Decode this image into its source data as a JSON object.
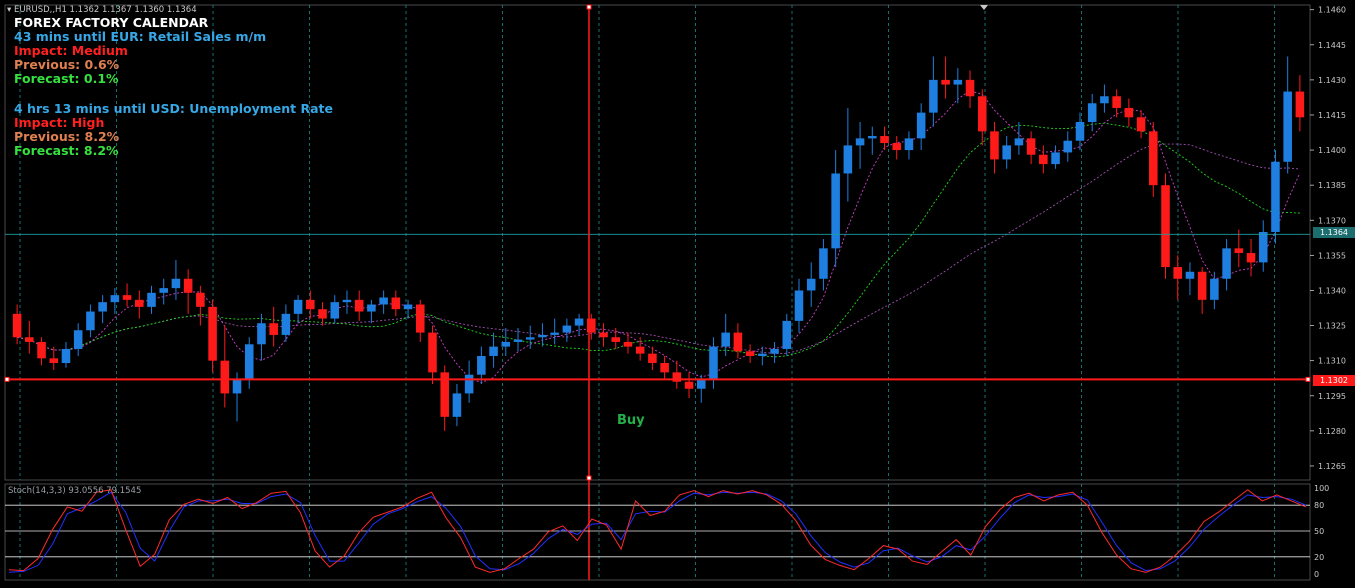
{
  "symbol_bar": {
    "text": "EURUSD,,H1  1.1362 1.1367 1.1360 1.1364"
  },
  "calendar": {
    "title": "FOREX FACTORY CALENDAR",
    "events": [
      {
        "countdown": "43 mins until EUR: Retail Sales m/m",
        "impact": "Impact: Medium",
        "previous": "Previous: 0.6%",
        "forecast": "Forecast: 0.1%"
      },
      {
        "countdown": "4 hrs 13 mins until USD: Unemployment Rate",
        "impact": "Impact: High",
        "previous": "Previous: 8.2%",
        "forecast": "Forecast: 8.2%"
      }
    ]
  },
  "colors": {
    "background": "#000000",
    "bull": "#1e7fe0",
    "bear": "#ff1a1a",
    "ma_fast": "#d040d0",
    "ma_mid": "#1fd81f",
    "ma_slow": "#a050b0",
    "grid": "#1c9fa0",
    "axis": "#c8c8c8",
    "stoch_main": "#ff2a2a",
    "stoch_signal": "#2030ff",
    "calendar_title": "#ffffff",
    "calendar_countdown": "#36a8e6",
    "impact": "#ff2020",
    "previous": "#e08050",
    "forecast": "#36e040"
  },
  "annotation": {
    "buy_label": "Buy"
  },
  "stochastic": {
    "label": "Stoch(14,3,3) 93.0556 79.1545",
    "levels": [
      "100",
      "80",
      "50",
      "20",
      "0"
    ]
  },
  "chart_data": {
    "type": "candlestick",
    "price_axis": {
      "ticks": [
        "1.1460",
        "1.1445",
        "1.1430",
        "1.1415",
        "1.1400",
        "1.1385",
        "1.1370",
        "1.1355",
        "1.1340",
        "1.1325",
        "1.1310",
        "1.1295",
        "1.1280",
        "1.1265"
      ],
      "current_price": "1.1364",
      "marked_price": "1.1302"
    },
    "ylim": [
      1.1259,
      1.1462
    ],
    "candles": [
      [
        1.133,
        1.1334,
        1.1317,
        1.132
      ],
      [
        1.132,
        1.1327,
        1.1313,
        1.1318
      ],
      [
        1.1318,
        1.132,
        1.1308,
        1.1311
      ],
      [
        1.1311,
        1.1316,
        1.1306,
        1.1309
      ],
      [
        1.1309,
        1.1318,
        1.1307,
        1.1315
      ],
      [
        1.1315,
        1.1326,
        1.1312,
        1.1323
      ],
      [
        1.1323,
        1.1334,
        1.132,
        1.1331
      ],
      [
        1.1331,
        1.1338,
        1.1326,
        1.1335
      ],
      [
        1.1335,
        1.1341,
        1.133,
        1.1338
      ],
      [
        1.1338,
        1.1343,
        1.1333,
        1.1336
      ],
      [
        1.1336,
        1.134,
        1.1328,
        1.1333
      ],
      [
        1.1333,
        1.1342,
        1.133,
        1.1339
      ],
      [
        1.1339,
        1.1345,
        1.1334,
        1.1341
      ],
      [
        1.1341,
        1.1353,
        1.1336,
        1.1345
      ],
      [
        1.1345,
        1.1349,
        1.133,
        1.1339
      ],
      [
        1.1339,
        1.1342,
        1.1325,
        1.1333
      ],
      [
        1.1333,
        1.1336,
        1.1305,
        1.131
      ],
      [
        1.131,
        1.1325,
        1.129,
        1.1296
      ],
      [
        1.1296,
        1.1305,
        1.1284,
        1.1302
      ],
      [
        1.1302,
        1.132,
        1.1298,
        1.1317
      ],
      [
        1.1317,
        1.133,
        1.131,
        1.1326
      ],
      [
        1.1326,
        1.1333,
        1.1316,
        1.1321
      ],
      [
        1.1321,
        1.1334,
        1.1318,
        1.133
      ],
      [
        1.133,
        1.1338,
        1.1326,
        1.1336
      ],
      [
        1.1336,
        1.134,
        1.1328,
        1.1332
      ],
      [
        1.1332,
        1.1335,
        1.1325,
        1.1328
      ],
      [
        1.1328,
        1.1338,
        1.1326,
        1.1335
      ],
      [
        1.1335,
        1.134,
        1.133,
        1.1336
      ],
      [
        1.1336,
        1.134,
        1.1327,
        1.1331
      ],
      [
        1.1331,
        1.1336,
        1.1326,
        1.1334
      ],
      [
        1.1334,
        1.134,
        1.133,
        1.1337
      ],
      [
        1.1337,
        1.134,
        1.1329,
        1.1332
      ],
      [
        1.1332,
        1.1336,
        1.1328,
        1.1334
      ],
      [
        1.1334,
        1.1336,
        1.1318,
        1.1322
      ],
      [
        1.1322,
        1.1325,
        1.13,
        1.1305
      ],
      [
        1.1305,
        1.1308,
        1.128,
        1.1286
      ],
      [
        1.1286,
        1.13,
        1.1282,
        1.1296
      ],
      [
        1.1296,
        1.131,
        1.1292,
        1.1304
      ],
      [
        1.1304,
        1.1316,
        1.13,
        1.1312
      ],
      [
        1.1312,
        1.1322,
        1.1307,
        1.1316
      ],
      [
        1.1316,
        1.1324,
        1.1312,
        1.1318
      ],
      [
        1.1318,
        1.1324,
        1.1314,
        1.1319
      ],
      [
        1.1319,
        1.1325,
        1.1315,
        1.132
      ],
      [
        1.132,
        1.1326,
        1.1316,
        1.1321
      ],
      [
        1.1321,
        1.1328,
        1.1317,
        1.1322
      ],
      [
        1.1322,
        1.1328,
        1.1318,
        1.1325
      ],
      [
        1.1325,
        1.133,
        1.1321,
        1.1328
      ],
      [
        1.1328,
        1.133,
        1.1319,
        1.1322
      ],
      [
        1.1322,
        1.1326,
        1.1316,
        1.132
      ],
      [
        1.132,
        1.1324,
        1.1315,
        1.1318
      ],
      [
        1.1318,
        1.1322,
        1.1313,
        1.1316
      ],
      [
        1.1316,
        1.132,
        1.131,
        1.1313
      ],
      [
        1.1313,
        1.1316,
        1.1306,
        1.1309
      ],
      [
        1.1309,
        1.1312,
        1.1302,
        1.1305
      ],
      [
        1.1305,
        1.131,
        1.1298,
        1.1301
      ],
      [
        1.1301,
        1.1305,
        1.1294,
        1.1298
      ],
      [
        1.1298,
        1.1304,
        1.1292,
        1.1302
      ],
      [
        1.1302,
        1.132,
        1.1298,
        1.1316
      ],
      [
        1.1316,
        1.133,
        1.1312,
        1.1322
      ],
      [
        1.1322,
        1.1326,
        1.1311,
        1.1314
      ],
      [
        1.1314,
        1.1317,
        1.1309,
        1.1312
      ],
      [
        1.1312,
        1.1316,
        1.1308,
        1.1313
      ],
      [
        1.1313,
        1.1318,
        1.1309,
        1.1315
      ],
      [
        1.1315,
        1.133,
        1.1312,
        1.1327
      ],
      [
        1.1327,
        1.1345,
        1.1322,
        1.134
      ],
      [
        1.134,
        1.1352,
        1.1333,
        1.1345
      ],
      [
        1.1345,
        1.1362,
        1.134,
        1.1358
      ],
      [
        1.1358,
        1.14,
        1.135,
        1.139
      ],
      [
        1.139,
        1.1418,
        1.1378,
        1.1402
      ],
      [
        1.1402,
        1.1412,
        1.1392,
        1.1405
      ],
      [
        1.1405,
        1.141,
        1.1398,
        1.1406
      ],
      [
        1.1406,
        1.141,
        1.14,
        1.1403
      ],
      [
        1.1403,
        1.1406,
        1.1396,
        1.14
      ],
      [
        1.14,
        1.1408,
        1.1396,
        1.1405
      ],
      [
        1.1405,
        1.142,
        1.14,
        1.1416
      ],
      [
        1.1416,
        1.144,
        1.141,
        1.143
      ],
      [
        1.143,
        1.144,
        1.1422,
        1.1428
      ],
      [
        1.1428,
        1.1435,
        1.142,
        1.143
      ],
      [
        1.143,
        1.1434,
        1.1418,
        1.1423
      ],
      [
        1.1423,
        1.1426,
        1.1402,
        1.1408
      ],
      [
        1.1408,
        1.1412,
        1.139,
        1.1396
      ],
      [
        1.1396,
        1.1406,
        1.1392,
        1.1402
      ],
      [
        1.1402,
        1.1412,
        1.1398,
        1.1405
      ],
      [
        1.1405,
        1.1408,
        1.1394,
        1.1398
      ],
      [
        1.1398,
        1.1402,
        1.139,
        1.1394
      ],
      [
        1.1394,
        1.1402,
        1.1392,
        1.1399
      ],
      [
        1.1399,
        1.1408,
        1.1395,
        1.1404
      ],
      [
        1.1404,
        1.1416,
        1.14,
        1.1412
      ],
      [
        1.1412,
        1.1424,
        1.1408,
        1.142
      ],
      [
        1.142,
        1.1428,
        1.1416,
        1.1423
      ],
      [
        1.1423,
        1.1426,
        1.1414,
        1.1418
      ],
      [
        1.1418,
        1.1422,
        1.141,
        1.1414
      ],
      [
        1.1414,
        1.1417,
        1.1405,
        1.1408
      ],
      [
        1.1408,
        1.1412,
        1.138,
        1.1385
      ],
      [
        1.1385,
        1.139,
        1.1345,
        1.135
      ],
      [
        1.135,
        1.1355,
        1.1336,
        1.1345
      ],
      [
        1.1345,
        1.1352,
        1.1338,
        1.1348
      ],
      [
        1.1348,
        1.135,
        1.133,
        1.1336
      ],
      [
        1.1336,
        1.1348,
        1.1332,
        1.1345
      ],
      [
        1.1345,
        1.1362,
        1.134,
        1.1358
      ],
      [
        1.1358,
        1.1366,
        1.135,
        1.1356
      ],
      [
        1.1356,
        1.1362,
        1.1346,
        1.1352
      ],
      [
        1.1352,
        1.137,
        1.1348,
        1.1365
      ],
      [
        1.1365,
        1.14,
        1.136,
        1.1395
      ],
      [
        1.1395,
        1.144,
        1.139,
        1.1425
      ],
      [
        1.1425,
        1.1432,
        1.1408,
        1.1414
      ]
    ],
    "stoch_main": [
      5,
      4,
      18,
      52,
      78,
      73,
      95,
      98,
      52,
      9,
      23,
      63,
      81,
      87,
      82,
      89,
      76,
      83,
      94,
      96,
      71,
      27,
      8,
      21,
      48,
      66,
      72,
      78,
      88,
      95,
      65,
      42,
      8,
      2,
      6,
      18,
      29,
      49,
      56,
      39,
      64,
      57,
      29,
      85,
      68,
      73,
      92,
      97,
      90,
      97,
      93,
      97,
      92,
      81,
      62,
      34,
      17,
      10,
      5,
      18,
      33,
      29,
      15,
      11,
      26,
      40,
      22,
      55,
      75,
      89,
      94,
      85,
      92,
      95,
      80,
      48,
      22,
      6,
      2,
      8,
      21,
      38,
      61,
      72,
      85,
      98,
      85,
      92,
      85,
      78
    ],
    "stoch_signal": [
      2,
      3,
      10,
      35,
      70,
      77,
      85,
      95,
      72,
      30,
      15,
      50,
      78,
      85,
      85,
      87,
      82,
      82,
      90,
      93,
      83,
      45,
      15,
      15,
      36,
      58,
      70,
      76,
      84,
      90,
      76,
      55,
      21,
      6,
      5,
      12,
      24,
      41,
      52,
      46,
      58,
      59,
      40,
      70,
      73,
      72,
      85,
      94,
      92,
      95,
      94,
      95,
      93,
      85,
      70,
      45,
      25,
      14,
      8,
      13,
      27,
      30,
      21,
      14,
      20,
      33,
      28,
      44,
      65,
      83,
      92,
      89,
      90,
      93,
      86,
      60,
      33,
      13,
      4,
      6,
      15,
      31,
      52,
      67,
      80,
      92,
      89,
      90,
      87,
      80
    ]
  }
}
